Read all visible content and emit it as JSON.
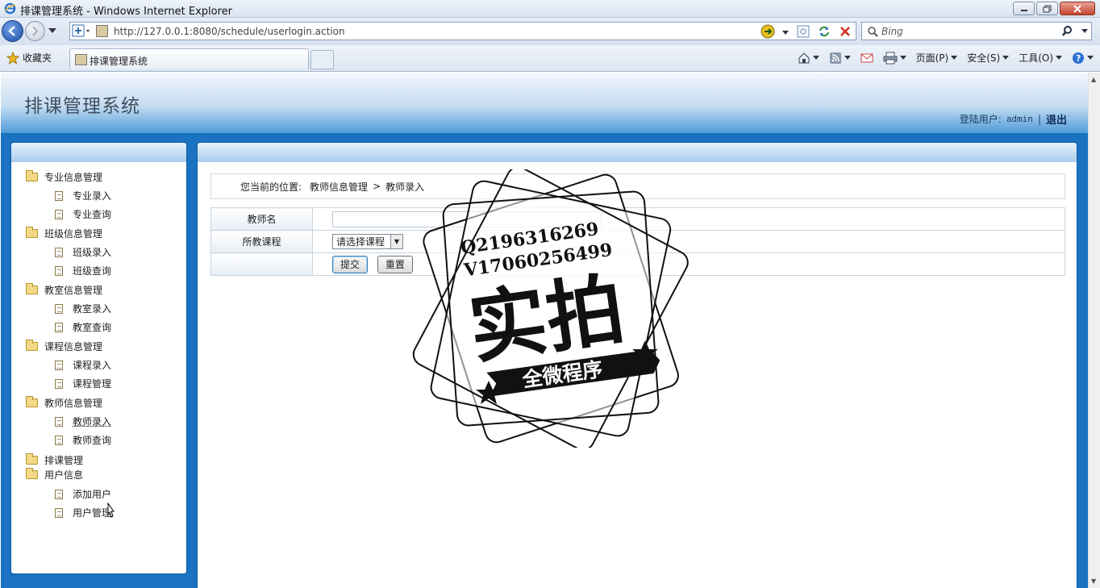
{
  "window": {
    "title": "排课管理系统 - Windows Internet Explorer",
    "url": "http://127.0.0.1:8080/schedule/userlogin.action",
    "search_placeholder": "Bing",
    "favorites_label": "收藏夹",
    "tab_title": "排课管理系统",
    "commands": [
      "页面(P)",
      "安全(S)",
      "工具(O)"
    ]
  },
  "app": {
    "title": "排课管理系统",
    "login_label": "登陆用户:",
    "username": "admin",
    "separator": "|",
    "logout": "退出"
  },
  "menu": [
    {
      "label": "专业信息管理",
      "items": [
        "专业录入",
        "专业查询"
      ]
    },
    {
      "label": "班级信息管理",
      "items": [
        "班级录入",
        "班级查询"
      ]
    },
    {
      "label": "教室信息管理",
      "items": [
        "教室录入",
        "教室查询"
      ]
    },
    {
      "label": "课程信息管理",
      "items": [
        "课程录入",
        "课程管理"
      ]
    },
    {
      "label": "教师信息管理",
      "items": [
        "教师录入",
        "教师查询"
      ]
    },
    {
      "label": "排课管理",
      "items": []
    },
    {
      "label": "用户信息",
      "items": [
        "添加用户",
        "用户管理"
      ]
    }
  ],
  "breadcrumb": {
    "prefix": "您当前的位置:",
    "section": "教师信息管理",
    "arrow": ">",
    "page": "教师录入"
  },
  "form": {
    "teacher_name_label": "教师名",
    "teacher_name_value": "",
    "course_label": "所教课程",
    "course_selected": "请选择课程",
    "submit_label": "提交",
    "reset_label": "重置"
  },
  "watermark": {
    "line1": "Q2196316269",
    "line2": "V17060256499",
    "main": "实拍",
    "ribbon": "全微程序"
  }
}
